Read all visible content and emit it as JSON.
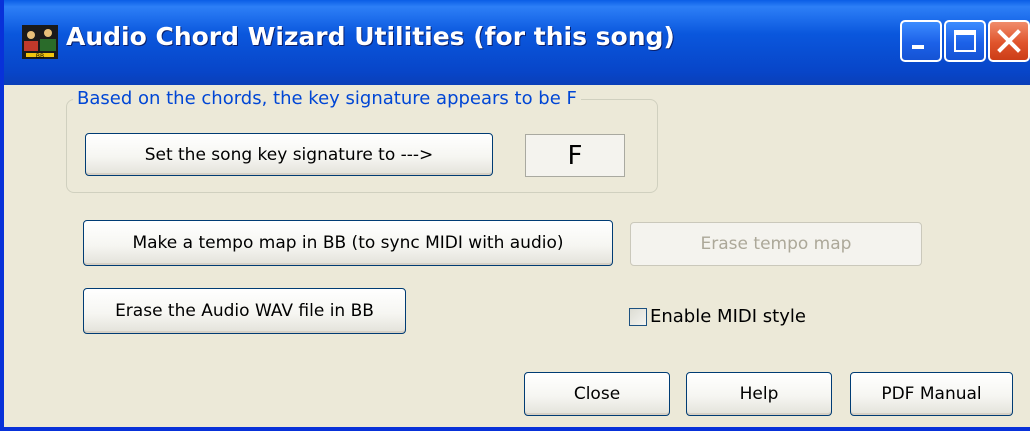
{
  "window": {
    "title": "Audio Chord Wizard Utilities (for this song)",
    "app_icon": "band-in-a-box-icon",
    "controls": [
      "minimize-icon",
      "maximize-icon",
      "close-icon"
    ]
  },
  "key_group": {
    "label": "Based on the chords, the key signature appears to be F",
    "set_key_button": "Set the song key signature to --->",
    "key_value": "F"
  },
  "tempo": {
    "make_button": "Make a tempo map in BB (to sync MIDI with audio)",
    "erase_button": "Erase tempo map"
  },
  "audio": {
    "erase_wav_button": "Erase the Audio WAV file in BB"
  },
  "midi_style": {
    "label": "Enable MIDI style",
    "checked": false
  },
  "footer": {
    "close_button": "Close",
    "help_button": "Help",
    "pdf_button": "PDF Manual"
  },
  "colors": {
    "titlebar": "#0a57dd",
    "window_bg": "#ece9d8",
    "group_label": "#0046d5",
    "close_button": "#e0542c"
  }
}
